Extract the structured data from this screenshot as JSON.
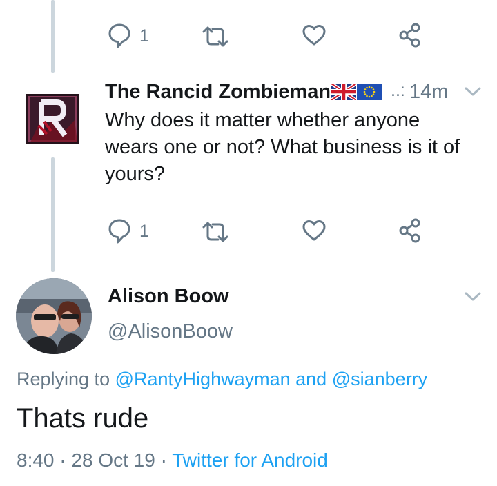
{
  "previous_tweet": {
    "actions": {
      "reply_count": "1"
    }
  },
  "tweet1": {
    "author": "The Rancid Zombieman",
    "avatar_letter": "R",
    "flags": [
      "uk-flag-icon",
      "eu-flag-icon"
    ],
    "name_ellipsis": "..:",
    "time": "14m",
    "text_lines": [
      "Why does it matter whether anyone",
      "wears one or not? What business is it of",
      "yours?"
    ],
    "actions": {
      "reply_count": "1"
    }
  },
  "tweet2": {
    "author": "Alison Boow",
    "handle": "@AlisonBoow",
    "replying_prefix": "Replying to",
    "replying_user1": "@RantyHighwayman",
    "replying_and": "and",
    "replying_user2": "@sianberry",
    "text": "Thats rude",
    "time": "8:40",
    "date": "28 Oct 19",
    "separator": "·",
    "source": "Twitter for Android"
  },
  "colors": {
    "link": "#1da1f2",
    "secondary": "#657786",
    "thread_line": "#ccd6dd",
    "text": "#14171a"
  }
}
